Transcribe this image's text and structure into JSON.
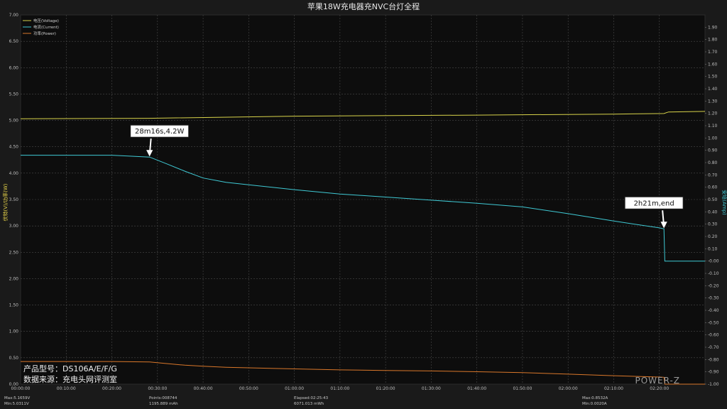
{
  "chart_data": {
    "type": "line",
    "title": "苹果18W充电器充NVC台灯全程",
    "ylabel_left": "伏特(V)/功率(W)",
    "ylabel_right": "安培(Amp)",
    "ylim_left": [
      0,
      7
    ],
    "ylim_right": [
      -1,
      2
    ],
    "xlim_minutes": [
      0,
      150
    ],
    "x_tick_labels": [
      "00:00:00",
      "00:10:00",
      "00:20:00",
      "00:30:00",
      "00:40:00",
      "00:50:00",
      "01:00:00",
      "01:10:00",
      "01:20:00",
      "01:30:00",
      "01:40:00",
      "01:50:00",
      "02:00:00",
      "02:10:00",
      "02:20:00"
    ],
    "y_left_ticks": [
      "0.00",
      "0.50",
      "1.00",
      "1.50",
      "2.00",
      "2.50",
      "3.00",
      "3.50",
      "4.00",
      "4.50",
      "5.00",
      "5.50",
      "6.00",
      "6.50",
      "7.00"
    ],
    "y_right_ticks": [
      "-1.00",
      "-0.90",
      "-0.80",
      "-0.70",
      "-0.60",
      "-0.50",
      "-0.40",
      "-0.30",
      "-0.20",
      "-0.10",
      "-0.00",
      "0.10",
      "0.20",
      "0.30",
      "0.40",
      "0.50",
      "0.60",
      "0.70",
      "0.80",
      "0.90",
      "1.00",
      "1.10",
      "1.20",
      "1.30",
      "1.40",
      "1.50",
      "1.60",
      "1.70",
      "1.80",
      "1.90"
    ],
    "legend": [
      "电压(Voltage)",
      "电流(Current)",
      "功率(Power)"
    ],
    "legend_position": "top-left",
    "grid": true,
    "series": [
      {
        "name": "电压(Voltage)",
        "axis": "left",
        "color": "#d8d34a",
        "x": [
          0,
          28,
          60,
          100,
          130,
          141,
          142,
          150
        ],
        "y": [
          5.03,
          5.04,
          5.08,
          5.1,
          5.12,
          5.13,
          5.16,
          5.17
        ]
      },
      {
        "name": "电流(Current)",
        "axis": "right",
        "color": "#3fc9d4",
        "x": [
          0,
          10,
          20,
          28.27,
          32,
          36,
          40,
          45,
          50,
          60,
          70,
          80,
          90,
          100,
          110,
          120,
          130,
          140,
          141,
          141.2,
          150
        ],
        "y": [
          0.86,
          0.86,
          0.86,
          0.845,
          0.79,
          0.73,
          0.675,
          0.64,
          0.62,
          0.58,
          0.545,
          0.52,
          0.495,
          0.47,
          0.44,
          0.385,
          0.325,
          0.27,
          0.262,
          0.0,
          0.0
        ]
      },
      {
        "name": "功率(Power)",
        "axis": "left",
        "color": "#d9772a",
        "x": [
          0,
          10,
          20,
          28.27,
          32,
          36,
          40,
          45,
          50,
          60,
          70,
          80,
          90,
          100,
          110,
          120,
          130,
          140,
          141,
          141.2,
          150
        ],
        "y": [
          0.43,
          0.43,
          0.43,
          0.42,
          0.39,
          0.36,
          0.34,
          0.32,
          0.31,
          0.29,
          0.27,
          0.26,
          0.25,
          0.235,
          0.22,
          0.19,
          0.16,
          0.135,
          0.13,
          0.0,
          0.0
        ]
      }
    ],
    "annotations": [
      {
        "text": "28m16s,4.2W",
        "x": 28.27,
        "y_right": 0.845
      },
      {
        "text": "2h21m,end",
        "x": 141,
        "y_right": 0.262
      }
    ],
    "stats": {
      "max_v": "Max:5.1659V",
      "min_v": "Min:5.0311V",
      "points": "Points:008744",
      "mah": "1195.889 mAh",
      "elapsed": "Elapsed:02:25:43",
      "mwh": "6071.013 mWh",
      "max_a": "Max:0.8532A",
      "min_a": "Min:0.0020A"
    },
    "info_lines": [
      "产品型号：DS106A/E/F/G",
      "数据来源：充电头网评测室"
    ],
    "watermark": "POWER-Z"
  }
}
